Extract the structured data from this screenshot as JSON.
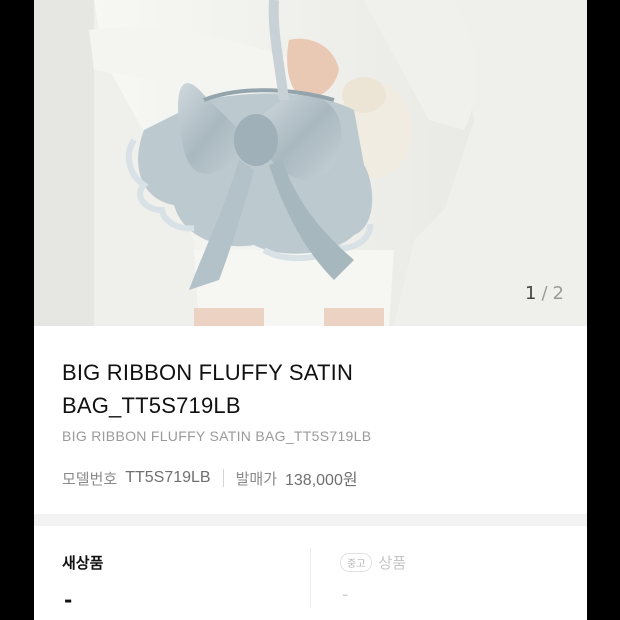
{
  "carousel": {
    "current_page": "1",
    "separator": "/",
    "total_pages": "2",
    "image_alt": "Model holding a light blue satin ribbon bag"
  },
  "product": {
    "title_line1": "BIG RIBBON FLUFFY SATIN",
    "title_line2": "BAG_TT5S719LB",
    "subtitle": "BIG RIBBON FLUFFY SATIN BAG_TT5S719LB",
    "model_number_label": "모델번호",
    "model_number": "TT5S719LB",
    "release_price_label": "발매가",
    "release_price": "138,000원"
  },
  "conditions": {
    "new_label": "새상품",
    "new_value": "-",
    "used_badge": "중고",
    "used_label": "상품",
    "used_value": "-"
  },
  "colors": {
    "background_frame": "#000000",
    "bag_satin": "#b9c6cc",
    "text_primary": "#111111",
    "text_secondary": "#9a9a9a"
  }
}
